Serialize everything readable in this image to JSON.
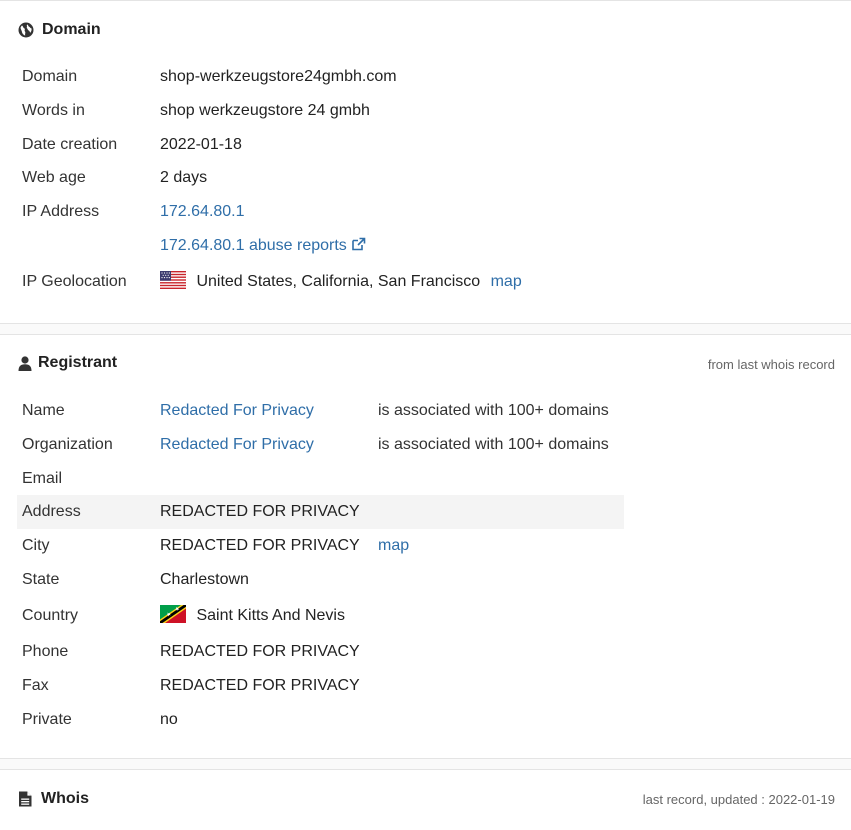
{
  "domain_section": {
    "title": "Domain",
    "icon": "globe-icon",
    "rows": {
      "domain": {
        "label": "Domain",
        "value": "shop-werkzeugstore24gmbh.com"
      },
      "words_in": {
        "label": "Words in",
        "value": "shop werkzeugstore 24 gmbh"
      },
      "date_creation": {
        "label": "Date creation",
        "value": "2022-01-18"
      },
      "web_age": {
        "label": "Web age",
        "value": "2 days"
      },
      "ip_address": {
        "label": "IP Address",
        "value": "172.64.80.1"
      },
      "abuse": {
        "value": "172.64.80.1 abuse reports"
      },
      "geolocation": {
        "label": "IP Geolocation",
        "value": "United States, California, San Francisco",
        "map_label": "map",
        "flag": "us-flag-icon"
      }
    }
  },
  "registrant_section": {
    "title": "Registrant",
    "icon": "user-icon",
    "note": "from last whois record",
    "rows": {
      "name": {
        "label": "Name",
        "value": "Redacted For Privacy",
        "extra": "is associated with 100+ domains"
      },
      "organization": {
        "label": "Organization",
        "value": "Redacted For Privacy",
        "extra": "is associated with 100+ domains"
      },
      "email": {
        "label": "Email",
        "value": ""
      },
      "address": {
        "label": "Address",
        "value": "REDACTED FOR PRIVACY"
      },
      "city": {
        "label": "City",
        "value": "REDACTED FOR PRIVACY",
        "map_label": "map"
      },
      "state": {
        "label": "State",
        "value": "Charlestown"
      },
      "country": {
        "label": "Country",
        "value": "Saint Kitts And Nevis",
        "flag": "kn-flag-icon"
      },
      "phone": {
        "label": "Phone",
        "value": "REDACTED FOR PRIVACY"
      },
      "fax": {
        "label": "Fax",
        "value": "REDACTED FOR PRIVACY"
      },
      "private": {
        "label": "Private",
        "value": "no"
      }
    }
  },
  "whois_section": {
    "title": "Whois",
    "icon": "document-icon",
    "note": "last record, updated : 2022-01-19"
  },
  "colors": {
    "link": "#2f6ea8",
    "highlight_row": "#f4f4f4",
    "note": "#666666"
  }
}
